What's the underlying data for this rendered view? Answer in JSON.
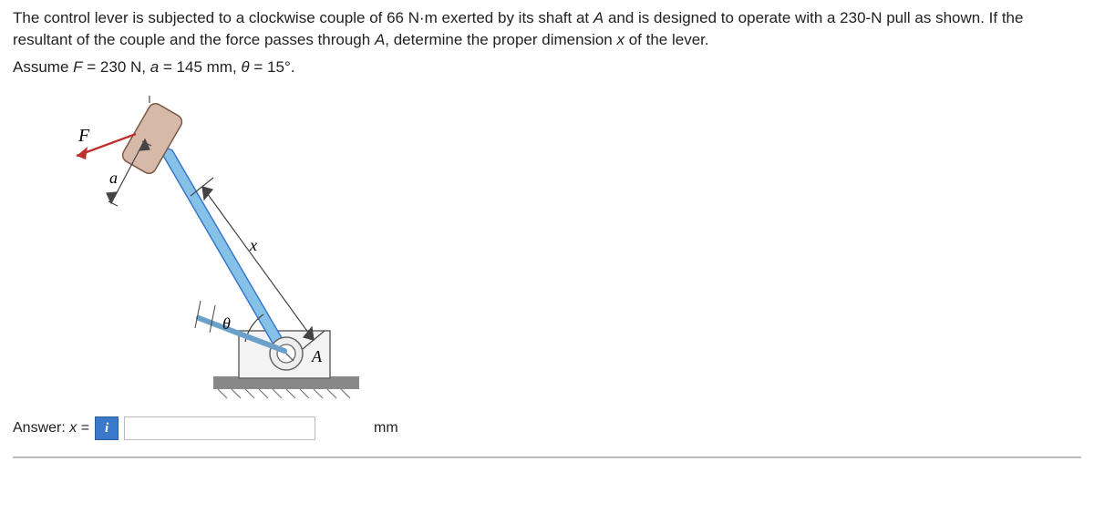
{
  "problem": {
    "line1_a": "The control lever is subjected to a clockwise couple of ",
    "line1_b": " N·m exerted by its shaft at ",
    "line1_c": " and is designed to operate with a ",
    "line1_d": "-N pull as shown. If the resultant of the couple and the force passes through ",
    "line1_e": ", determine the proper dimension ",
    "line1_f": " of the lever.",
    "couple_value": "66",
    "point_A_1": "A",
    "pull_value": "230",
    "point_A_2": "A",
    "dim_sym": "x",
    "assume_prefix": "Assume ",
    "F_sym": "F",
    "F_val": " = 230 N, ",
    "a_sym": "a",
    "a_val": " = 145 mm, ",
    "theta_sym": "θ",
    "theta_val": " =  15°."
  },
  "figure": {
    "F": "F",
    "a": "a",
    "x": "x",
    "theta": "θ",
    "A": "A"
  },
  "answer": {
    "label_prefix": "Answer: ",
    "x_sym": "x",
    "equals": " = ",
    "info_badge": "i",
    "value": "",
    "unit": "mm"
  }
}
